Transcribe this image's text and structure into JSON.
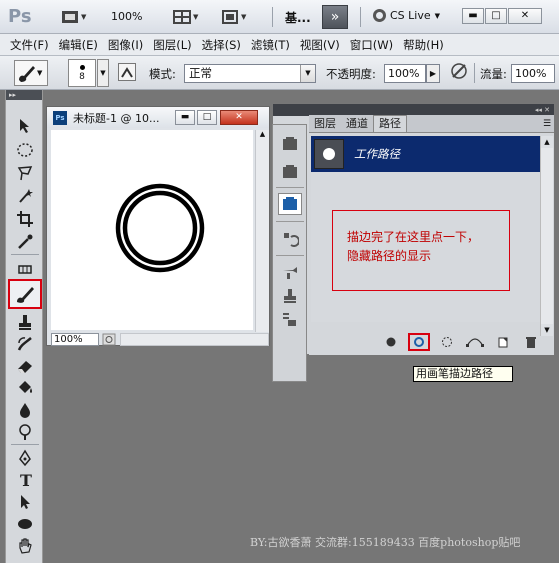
{
  "appbar": {
    "logo": "Ps",
    "zoom": "100%",
    "workspace": "基...",
    "cslive": "CS Live",
    "win_min": "▬",
    "win_max": "□",
    "win_close": "✕"
  },
  "menu": [
    "文件(F)",
    "编辑(E)",
    "图像(I)",
    "图层(L)",
    "选择(S)",
    "滤镜(T)",
    "视图(V)",
    "窗口(W)",
    "帮助(H)"
  ],
  "options": {
    "brush_size": "8",
    "mode_label": "模式:",
    "mode_value": "正常",
    "opacity_label": "不透明度:",
    "opacity_value": "100%",
    "flow_label": "流量:",
    "flow_value": "100%"
  },
  "document": {
    "title": "未标题-1 @ 10...",
    "zoom": "100%"
  },
  "paths_panel": {
    "tabs": [
      "图层",
      "通道",
      "路径"
    ],
    "active_tab": 2,
    "path_name": "工作路径"
  },
  "annotation": {
    "line1": "描边完了在这里点一下，",
    "line2": "隐藏路径的显示"
  },
  "tooltip": "用画笔描边路径",
  "credit": "BY:古欲香萧  交流群:155189433  百度photoshop贴吧",
  "colors": {
    "highlight_red": "#d8000f",
    "path_row_blue": "#0c2a6e",
    "workspace_gray": "#767676"
  }
}
